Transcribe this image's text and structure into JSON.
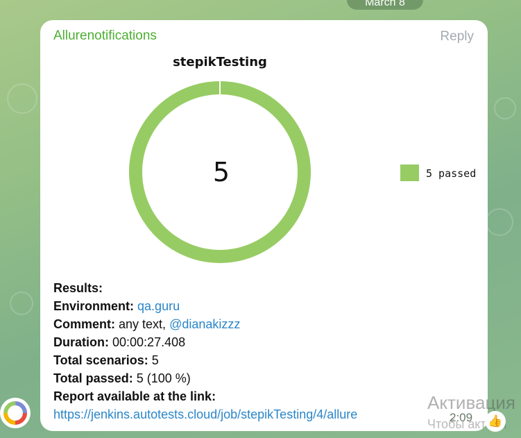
{
  "date_pill": "March 8",
  "message": {
    "sender": "Allurenotifications",
    "reply_label": "Reply",
    "time": "2:09",
    "reaction_icon": "thumbs-up-icon"
  },
  "chart_data": {
    "type": "pie",
    "title": "stepikTesting",
    "center_label": "5",
    "categories": [
      "passed"
    ],
    "values": [
      5
    ],
    "legend": [
      {
        "label": "5 passed",
        "color": "#97cc64"
      }
    ],
    "legend_placement": "right",
    "colors": [
      "#97cc64"
    ]
  },
  "results": {
    "heading": "Results:",
    "environment_label": "Environment:",
    "environment_value": "qa.guru",
    "comment_label": "Comment:",
    "comment_text": "any text,",
    "comment_mention": "@dianakizzz",
    "duration_label": "Duration:",
    "duration_value": "00:00:27.408",
    "total_scenarios_label": "Total scenarios:",
    "total_scenarios_value": "5",
    "total_passed_label": "Total passed:",
    "total_passed_value": "5 (100 %)",
    "report_label": "Report available at the link:",
    "report_url": "https://jenkins.autotests.cloud/job/stepikTesting/4/allure"
  },
  "watermark": {
    "line1": "Активация",
    "line2": "Чтобы активи"
  },
  "colors": {
    "sender": "#4caf32",
    "link": "#2a86c9",
    "donut": "#97cc64"
  }
}
